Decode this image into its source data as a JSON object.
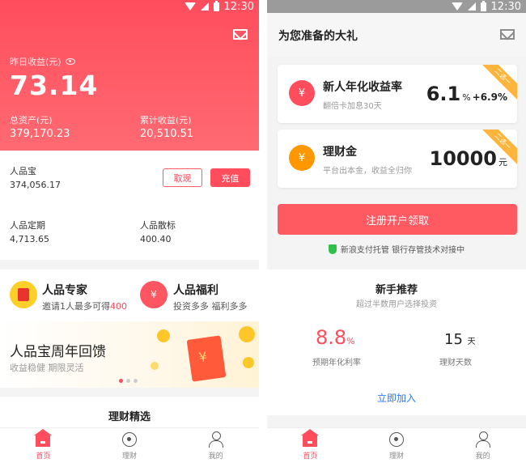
{
  "status": {
    "time": "12:30"
  },
  "left": {
    "yesterday_label": "昨日收益(元)",
    "yesterday_value": "73.14",
    "total_assets_label": "总资产(元)",
    "total_assets_value": "379,170.23",
    "cumulative_label": "累计收益(元)",
    "cumulative_value": "20,510.51",
    "renpinbao_label": "人品宝",
    "renpinbao_value": "374,056.17",
    "withdraw_label": "取现",
    "recharge_label": "充值",
    "fixed_label": "人品定期",
    "fixed_value": "4,713.65",
    "loose_label": "人品散标",
    "loose_value": "400.40",
    "expert": {
      "title": "人品专家",
      "sub_prefix": "邀请1人最多可得",
      "sub_amount": "400"
    },
    "welfare": {
      "title": "人品福利",
      "sub": "投资多多 福利多多",
      "icon_char": "¥"
    },
    "banner": {
      "title": "人品宝周年回馈",
      "sub": "收益稳健 期限灵活",
      "env_char": "¥"
    },
    "picks_title": "理财精选"
  },
  "right": {
    "title": "为您准备的大礼",
    "cards": [
      {
        "name": "新人年化收益率",
        "sub": "翻倍卡加息30天",
        "value": "6.1",
        "unit": "%",
        "bonus": "+6.9%",
        "ribbon": "二选一",
        "icon": "¥"
      },
      {
        "name": "理财金",
        "sub": "平台出本金，收益全归你",
        "value": "10000",
        "unit": "元",
        "bonus": "",
        "ribbon": "二选一",
        "icon": "¥"
      }
    ],
    "cta": "注册开户领取",
    "secure": "新浪支付托管 银行存管技术对接中",
    "newbie": {
      "title": "新手推荐",
      "sub": "超过半数用户选择投资",
      "rate": "8.8",
      "rate_unit": "%",
      "rate_label": "预期年化利率",
      "days": "15",
      "days_unit": "天",
      "days_label": "理财天数",
      "join": "立即加入"
    }
  },
  "tabs": [
    {
      "label": "首页",
      "icon": "home-icon"
    },
    {
      "label": "理财",
      "icon": "compass-icon"
    },
    {
      "label": "我的",
      "icon": "user-icon"
    }
  ],
  "colors": {
    "brand": "#ff4d5d",
    "accent": "#ff9800",
    "link": "#2979ff"
  }
}
